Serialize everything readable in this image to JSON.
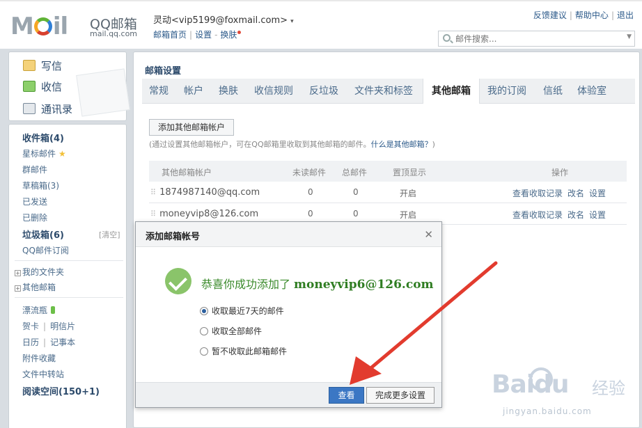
{
  "header": {
    "logo_text": "MOil",
    "logo_cn": "QQ邮箱",
    "logo_domain": "mail.qq.com",
    "user_name": "灵动",
    "user_email": "<vip5199@foxmail.com>",
    "account_caret": "▾",
    "links": [
      "邮箱首页",
      "设置",
      "换肤"
    ],
    "top_links": [
      "反馈建议",
      "帮助中心",
      "退出"
    ],
    "search_placeholder": "邮件搜索..."
  },
  "sidebar": {
    "compose": "写信",
    "receive": "收信",
    "contacts": "通讯录",
    "inbox": "收件箱(4)",
    "starred": "星标邮件",
    "group": "群邮件",
    "drafts": "草稿箱(3)",
    "sent": "已发送",
    "deleted": "已删除",
    "junk": "垃圾箱(6)",
    "clear": "[清空]",
    "subscription": "QQ邮件订阅",
    "my_folders": "我的文件夹",
    "other_mail": "其他邮箱",
    "bottle": "漂流瓶",
    "card": "贺卡",
    "postcard": "明信片",
    "calendar": "日历",
    "notes": "记事本",
    "attachments": "附件收藏",
    "file_transfer": "文件中转站",
    "reading": "阅读空间(150+1)"
  },
  "main": {
    "title": "邮箱设置",
    "tabs": [
      "常规",
      "帐户",
      "换肤",
      "收信规则",
      "反垃圾",
      "文件夹和标签",
      "其他邮箱",
      "我的订阅",
      "信纸",
      "体验室"
    ],
    "active_tab": "其他邮箱",
    "add_button": "添加其他邮箱帐户",
    "hint_prefix": "(通过设置其他邮箱帐户，可在QQ邮箱里收取到其他邮箱的邮件。",
    "hint_link": "什么是其他邮箱？",
    "hint_suffix": ")",
    "columns": [
      "其他邮箱帐户",
      "未读邮件",
      "总邮件",
      "置顶显示",
      "操作"
    ],
    "rows": [
      {
        "account": "1874987140@qq.com",
        "unread": "0",
        "total": "0",
        "pinned": "开启",
        "op_log": "查看收取记录",
        "op_rename": "改名",
        "op_settings": "设置"
      },
      {
        "account": "moneyvip8@126.com",
        "unread": "0",
        "total": "0",
        "pinned": "开启",
        "op_log": "查看收取记录",
        "op_rename": "改名",
        "op_settings": "设置"
      }
    ]
  },
  "modal": {
    "title": "添加邮箱帐号",
    "close": "✕",
    "success_text": "恭喜你成功添加了",
    "success_email": "moneyvip6@126.com",
    "options": [
      "收取最近7天的邮件",
      "收取全部邮件",
      "暂不收取此邮箱邮件"
    ],
    "selected_option": 0,
    "btn_view": "查看",
    "btn_more": "完成更多设置"
  },
  "watermark": {
    "logo": "Baidu",
    "text": "经验",
    "url": "jingyan.baidu.com"
  },
  "colors": {
    "accent": "#3b77c4",
    "success": "#3a8a2a",
    "arrow": "#e23b2e"
  }
}
